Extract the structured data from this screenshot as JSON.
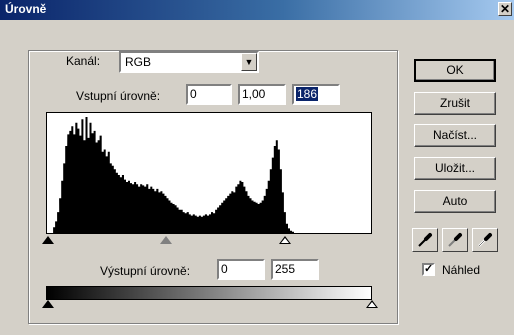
{
  "window": {
    "title": "Úrovně",
    "close_glyph": "✕"
  },
  "channel": {
    "label": "Kanál:",
    "value": "RGB",
    "arrow_glyph": "▼"
  },
  "input_levels": {
    "label": "Vstupní úrovně:",
    "black": "0",
    "gamma": "1,00",
    "white": "186"
  },
  "output_levels": {
    "label": "Výstupní úrovně:",
    "black": "0",
    "white": "255"
  },
  "buttons": {
    "ok": "OK",
    "cancel": "Zrušit",
    "load": "Načíst...",
    "save": "Uložit...",
    "auto": "Auto"
  },
  "eyedroppers": [
    "black-eyedropper-icon",
    "gray-eyedropper-icon",
    "white-eyedropper-icon"
  ],
  "preview": {
    "label": "Náhled",
    "checked": true
  },
  "histogram_profile": [
    0,
    0,
    0,
    5,
    10,
    18,
    30,
    45,
    60,
    75,
    85,
    88,
    92,
    85,
    95,
    90,
    84,
    98,
    80,
    100,
    82,
    95,
    86,
    88,
    78,
    80,
    84,
    70,
    72,
    66,
    70,
    60,
    58,
    55,
    52,
    50,
    48,
    50,
    46,
    44,
    45,
    43,
    42,
    44,
    42,
    40,
    42,
    41,
    40,
    42,
    38,
    40,
    38,
    36,
    38,
    35,
    36,
    34,
    32,
    30,
    28,
    26,
    25,
    24,
    22,
    20,
    20,
    18,
    17,
    18,
    16,
    15,
    16,
    15,
    14,
    15,
    14,
    15,
    16,
    15,
    16,
    18,
    17,
    20,
    22,
    24,
    26,
    28,
    30,
    32,
    34,
    36,
    35,
    40,
    42,
    45,
    44,
    40,
    36,
    32,
    30,
    28,
    27,
    26,
    25,
    26,
    28,
    32,
    38,
    45,
    55,
    65,
    75,
    80,
    72,
    55,
    35,
    18,
    8,
    4,
    2,
    1,
    0,
    0,
    0,
    0,
    0,
    0,
    0,
    0,
    0,
    0,
    0,
    0,
    0,
    0,
    0,
    0,
    0,
    0,
    0,
    0,
    0,
    0,
    0,
    0,
    0,
    0,
    0,
    0,
    0,
    0,
    0,
    0,
    0,
    0,
    0,
    0,
    0,
    0
  ],
  "colors": {
    "title_start": "#0a246a",
    "title_end": "#a6caf0",
    "selection": "#0a246a",
    "face": "#d4d0c8"
  }
}
